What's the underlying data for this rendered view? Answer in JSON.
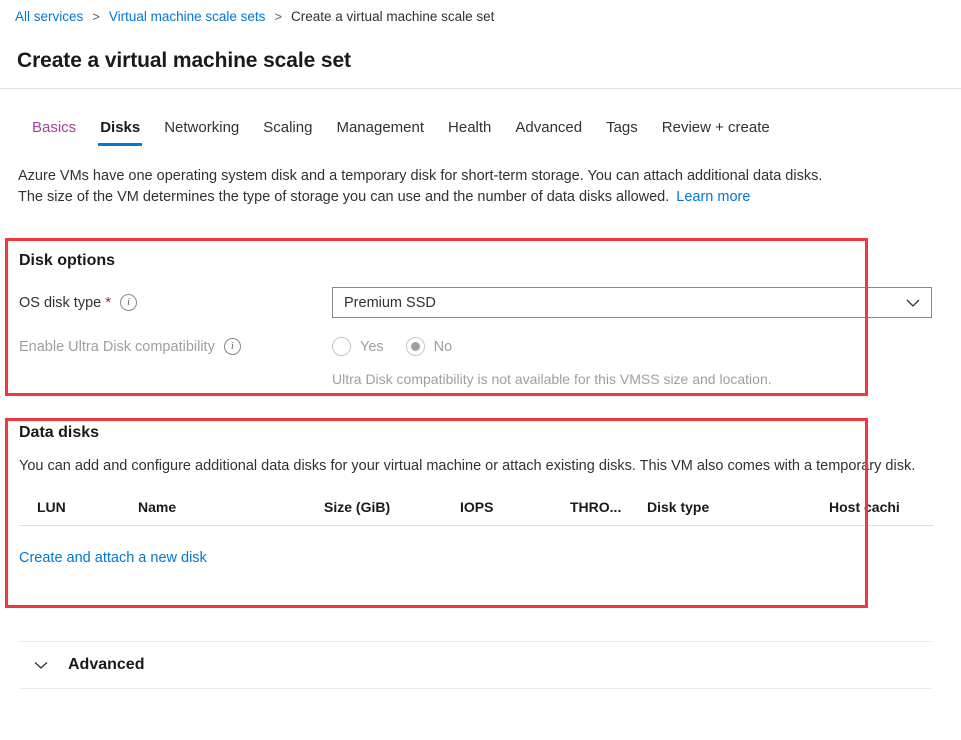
{
  "breadcrumb": {
    "items": [
      {
        "label": "All services",
        "type": "link"
      },
      {
        "label": "Virtual machine scale sets",
        "type": "link"
      },
      {
        "label": "Create a virtual machine scale set",
        "type": "current"
      }
    ],
    "separator": ">"
  },
  "header": {
    "title": "Create a virtual machine scale set"
  },
  "tabs": [
    {
      "label": "Basics",
      "state": "visited"
    },
    {
      "label": "Disks",
      "state": "active"
    },
    {
      "label": "Networking",
      "state": "default"
    },
    {
      "label": "Scaling",
      "state": "default"
    },
    {
      "label": "Management",
      "state": "default"
    },
    {
      "label": "Health",
      "state": "default"
    },
    {
      "label": "Advanced",
      "state": "default"
    },
    {
      "label": "Tags",
      "state": "default"
    },
    {
      "label": "Review + create",
      "state": "default"
    }
  ],
  "intro": {
    "line1": "Azure VMs have one operating system disk and a temporary disk for short-term storage. You can attach additional data disks.",
    "line2": "The size of the VM determines the type of storage you can use and the number of data disks allowed.",
    "learn_more": "Learn more"
  },
  "disk_options": {
    "title": "Disk options",
    "os_disk_type": {
      "label": "OS disk type",
      "required_marker": "*",
      "info_icon": "info-icon",
      "value": "Premium SSD",
      "chevron_icon": "chevron-down-icon"
    },
    "ultra_disk": {
      "label": "Enable Ultra Disk compatibility",
      "info_icon": "info-icon",
      "options": [
        {
          "label": "Yes",
          "selected": false
        },
        {
          "label": "No",
          "selected": true
        }
      ],
      "disabled": true,
      "helper_text": "Ultra Disk compatibility is not available for this VMSS size and location."
    }
  },
  "data_disks": {
    "title": "Data disks",
    "description": "You can add and configure additional data disks for your virtual machine or attach existing disks. This VM also comes with a temporary disk.",
    "columns": [
      "LUN",
      "Name",
      "Size (GiB)",
      "IOPS",
      "THRO...",
      "Disk type",
      "Host cachi"
    ],
    "rows": [],
    "create_link": "Create and attach a new disk"
  },
  "advanced_section": {
    "label": "Advanced",
    "chevron_icon": "chevron-down-icon",
    "expanded": false
  },
  "highlights": [
    {
      "name": "disk-options-highlight",
      "color": "#f0383e"
    },
    {
      "name": "data-disks-highlight",
      "color": "#f0383e"
    }
  ]
}
